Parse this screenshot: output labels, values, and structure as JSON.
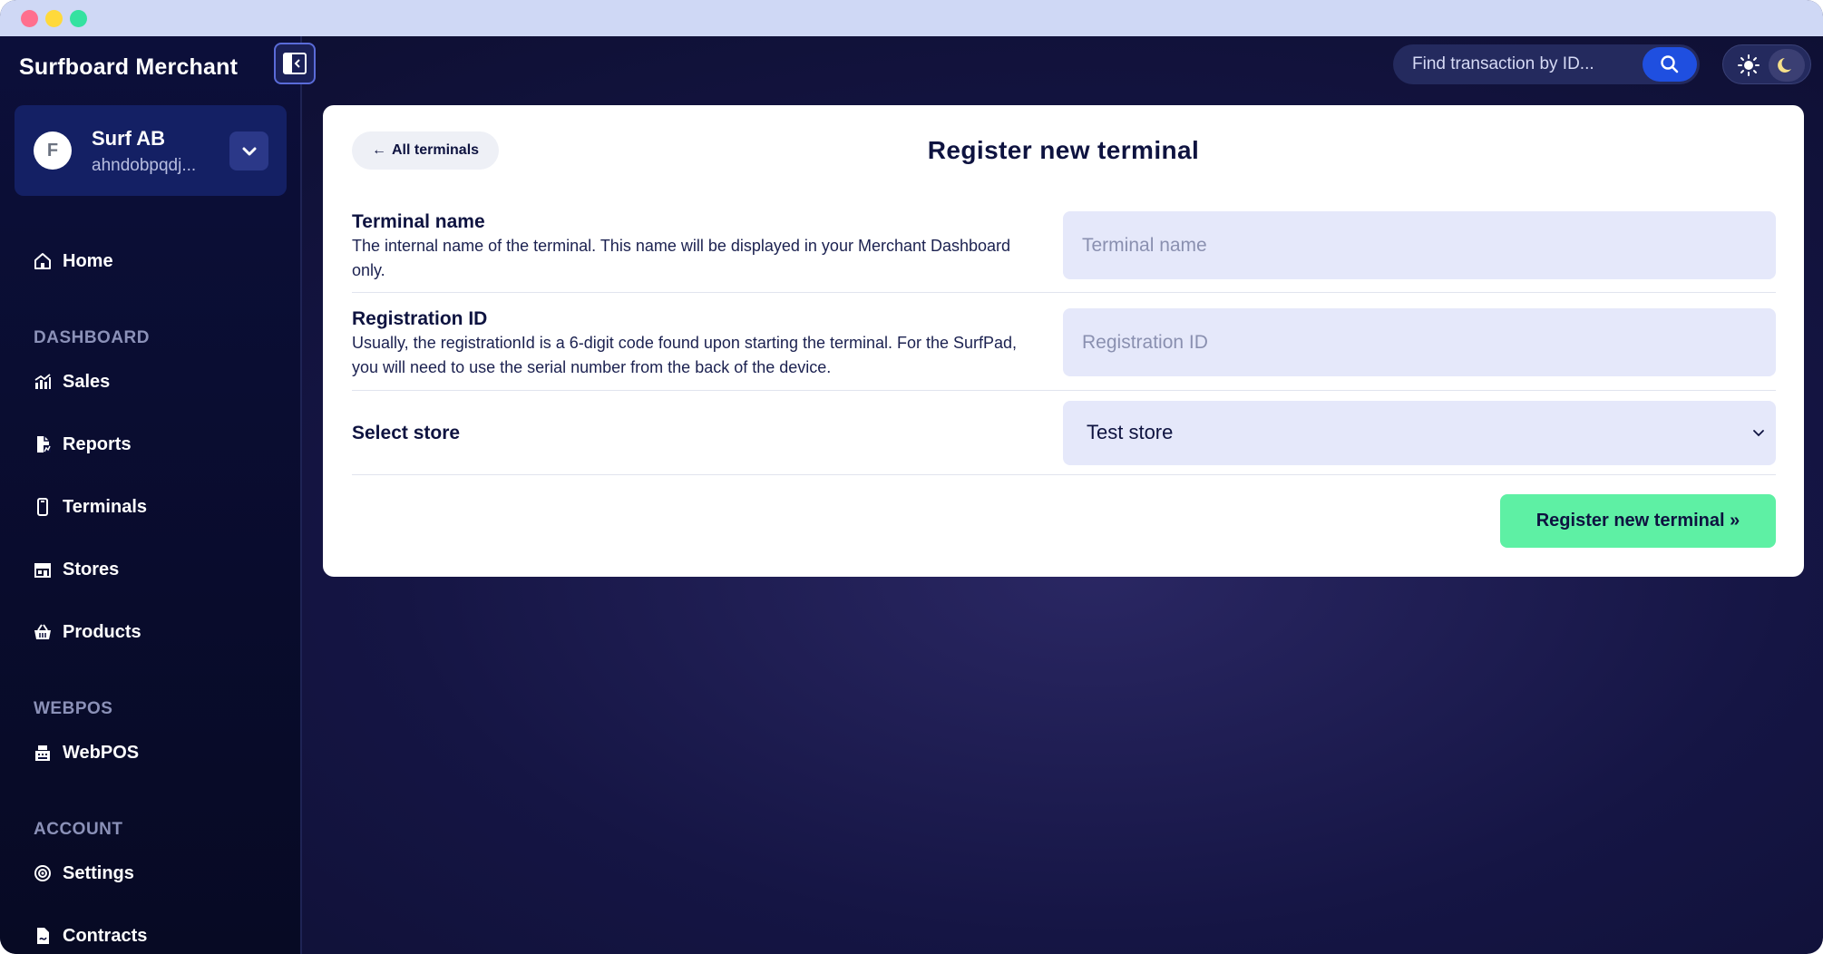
{
  "window": {
    "controls": [
      "close",
      "minimize",
      "maximize"
    ]
  },
  "sidebar": {
    "brand": "Surfboard Merchant",
    "account": {
      "initial": "F",
      "name": "Surf AB",
      "id": "ahndobpqdj..."
    },
    "home": {
      "label": "Home",
      "icon": "home-icon"
    },
    "sections": [
      {
        "title": "DASHBOARD",
        "items": [
          {
            "label": "Sales",
            "icon": "chart-icon"
          },
          {
            "label": "Reports",
            "icon": "report-icon"
          },
          {
            "label": "Terminals",
            "icon": "terminal-icon"
          },
          {
            "label": "Stores",
            "icon": "store-icon"
          },
          {
            "label": "Products",
            "icon": "basket-icon"
          }
        ]
      },
      {
        "title": "WEBPOS",
        "items": [
          {
            "label": "WebPOS",
            "icon": "register-icon"
          }
        ]
      },
      {
        "title": "ACCOUNT",
        "items": [
          {
            "label": "Settings",
            "icon": "settings-icon"
          },
          {
            "label": "Contracts",
            "icon": "contract-icon"
          }
        ]
      }
    ]
  },
  "header": {
    "search": {
      "placeholder": "Find transaction by ID...",
      "value": ""
    },
    "theme": {
      "active": "dark"
    }
  },
  "form": {
    "back_label": "All terminals",
    "title": "Register new terminal",
    "terminal_name": {
      "label": "Terminal name",
      "description": "The internal name of the terminal. This name will be displayed in your Merchant Dashboard only.",
      "placeholder": "Terminal name",
      "value": ""
    },
    "registration_id": {
      "label": "Registration ID",
      "description": "Usually, the registrationId is a 6-digit code found upon starting the terminal. For the SurfPad, you will need to use the serial number from the back of the device.",
      "placeholder": "Registration ID",
      "value": ""
    },
    "store": {
      "label": "Select store",
      "selected": "Test store"
    },
    "submit_label": "Register new terminal »"
  },
  "colors": {
    "accent_green": "#5ef0a4",
    "accent_blue": "#1f4fe0",
    "sidebar_bg": "#0c0f3a",
    "input_bg": "#e5e8fa"
  }
}
